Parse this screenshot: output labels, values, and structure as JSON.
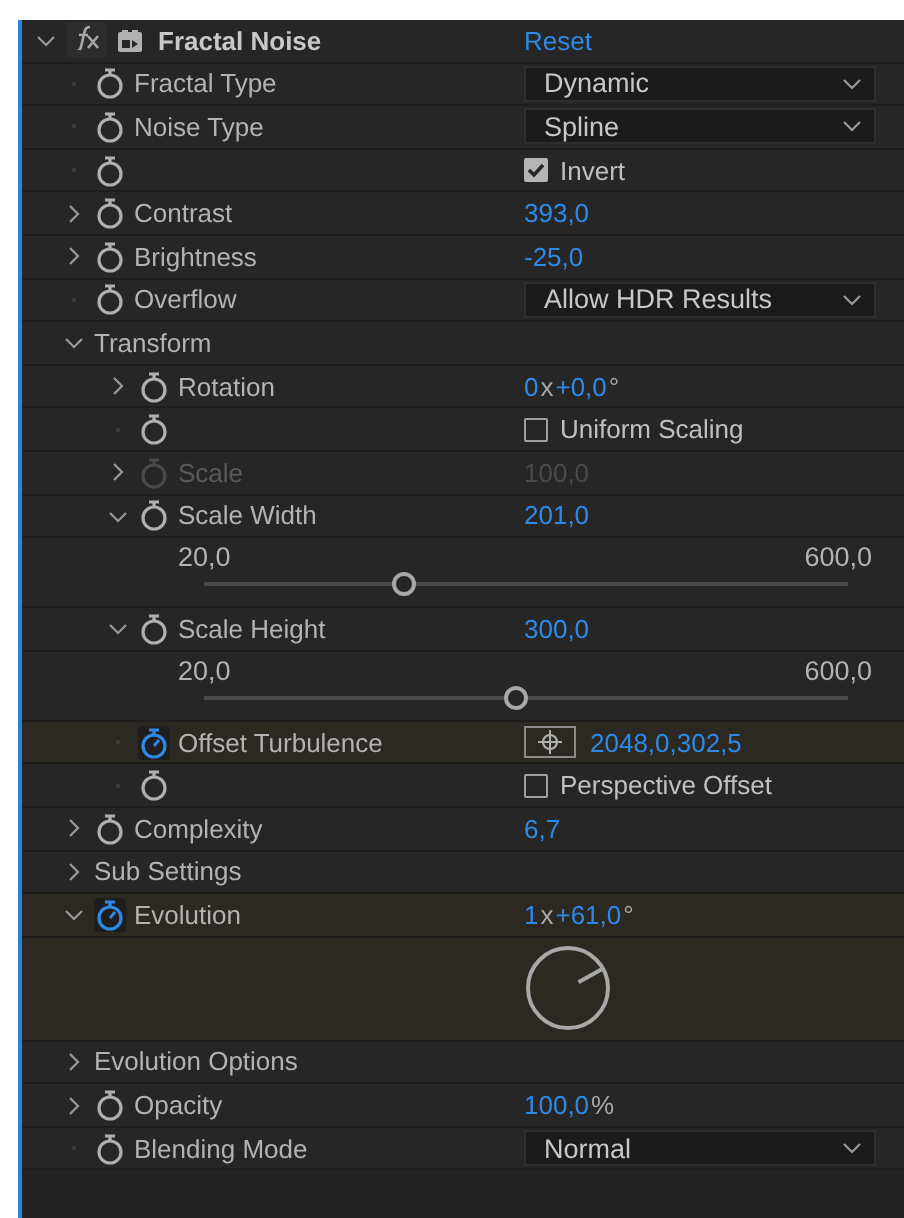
{
  "effect": {
    "name": "Fractal Noise",
    "expanded": true,
    "reset": "Reset",
    "properties": [
      {
        "kind": "dropdown",
        "label": "Fractal Type",
        "expandable": false,
        "expanded": false,
        "stopwatch": true,
        "animated": false,
        "disabled": false,
        "value": "Dynamic"
      },
      {
        "kind": "dropdown",
        "label": "Noise Type",
        "expandable": false,
        "expanded": false,
        "stopwatch": true,
        "animated": false,
        "disabled": false,
        "value": "Spline"
      },
      {
        "kind": "checkbox",
        "expandable": false,
        "expanded": false,
        "stopwatch": true,
        "animated": false,
        "disabled": false,
        "checked": true,
        "text": "Invert"
      },
      {
        "kind": "number",
        "label": "Contrast",
        "expandable": true,
        "expanded": false,
        "stopwatch": true,
        "animated": false,
        "disabled": false,
        "parts": [
          {
            "kind": "number",
            "text": "393,0"
          }
        ]
      },
      {
        "kind": "number",
        "label": "Brightness",
        "expandable": true,
        "expanded": false,
        "stopwatch": true,
        "animated": false,
        "disabled": false,
        "parts": [
          {
            "kind": "number",
            "text": "-25,0"
          }
        ]
      },
      {
        "kind": "dropdown",
        "label": "Overflow",
        "expandable": false,
        "expanded": false,
        "stopwatch": true,
        "animated": false,
        "disabled": false,
        "value": "Allow HDR Results"
      },
      {
        "kind": "group",
        "label": "Transform",
        "expandable": true,
        "expanded": true,
        "stopwatch": false,
        "animated": false,
        "disabled": false,
        "children": [
          {
            "kind": "angle",
            "label": "Rotation",
            "expandable": true,
            "expanded": false,
            "stopwatch": true,
            "animated": false,
            "disabled": false,
            "parts": [
              {
                "kind": "number",
                "text": "0"
              },
              {
                "kind": "unit",
                "text": "x"
              },
              {
                "kind": "number",
                "text": "+0,0"
              },
              {
                "kind": "unit",
                "text": "°"
              }
            ]
          },
          {
            "kind": "checkbox",
            "expandable": false,
            "expanded": false,
            "stopwatch": true,
            "animated": false,
            "disabled": false,
            "checked": false,
            "text": "Uniform Scaling"
          },
          {
            "kind": "number",
            "label": "Scale",
            "expandable": true,
            "expanded": false,
            "stopwatch": true,
            "animated": false,
            "disabled": true,
            "parts": [
              {
                "kind": "number",
                "text": "100,0"
              }
            ]
          },
          {
            "kind": "number",
            "label": "Scale Width",
            "expandable": true,
            "expanded": true,
            "stopwatch": true,
            "animated": false,
            "disabled": false,
            "parts": [
              {
                "kind": "number",
                "text": "201,0"
              }
            ],
            "slider": {
              "min": "20,0",
              "max": "600,0",
              "level": 0.312
            }
          },
          {
            "kind": "number",
            "label": "Scale Height",
            "expandable": true,
            "expanded": true,
            "stopwatch": true,
            "animated": false,
            "disabled": false,
            "parts": [
              {
                "kind": "number",
                "text": "300,0"
              }
            ],
            "slider": {
              "min": "20,0",
              "max": "600,0",
              "level": 0.483
            }
          },
          {
            "kind": "point",
            "label": "Offset Turbulence",
            "expandable": false,
            "expanded": false,
            "stopwatch": true,
            "animated": true,
            "disabled": false,
            "value": "2048,0,302,5"
          },
          {
            "kind": "checkbox",
            "expandable": false,
            "expanded": false,
            "stopwatch": true,
            "animated": false,
            "disabled": false,
            "checked": false,
            "text": "Perspective Offset"
          }
        ]
      },
      {
        "kind": "number",
        "label": "Complexity",
        "expandable": true,
        "expanded": false,
        "stopwatch": true,
        "animated": false,
        "disabled": false,
        "parts": [
          {
            "kind": "number",
            "text": "6,7"
          }
        ]
      },
      {
        "kind": "group",
        "label": "Sub Settings",
        "expandable": true,
        "expanded": false,
        "stopwatch": false,
        "animated": false,
        "disabled": false
      },
      {
        "kind": "angle",
        "label": "Evolution",
        "expandable": true,
        "expanded": true,
        "stopwatch": true,
        "animated": true,
        "disabled": false,
        "parts": [
          {
            "kind": "number",
            "text": "1"
          },
          {
            "kind": "unit",
            "text": "x"
          },
          {
            "kind": "number",
            "text": "+61,0"
          },
          {
            "kind": "unit",
            "text": "°"
          }
        ]
      },
      {
        "kind": "group",
        "label": "Evolution Options",
        "expandable": true,
        "expanded": false,
        "stopwatch": false,
        "animated": false,
        "disabled": false
      },
      {
        "kind": "number",
        "label": "Opacity",
        "expandable": true,
        "expanded": false,
        "stopwatch": true,
        "animated": false,
        "disabled": false,
        "parts": [
          {
            "kind": "number",
            "text": "100,0"
          },
          {
            "kind": "unit",
            "text": "%"
          }
        ]
      },
      {
        "kind": "dropdown",
        "label": "Blending Mode",
        "expandable": false,
        "expanded": false,
        "stopwatch": true,
        "animated": false,
        "disabled": false,
        "value": "Normal"
      }
    ]
  }
}
